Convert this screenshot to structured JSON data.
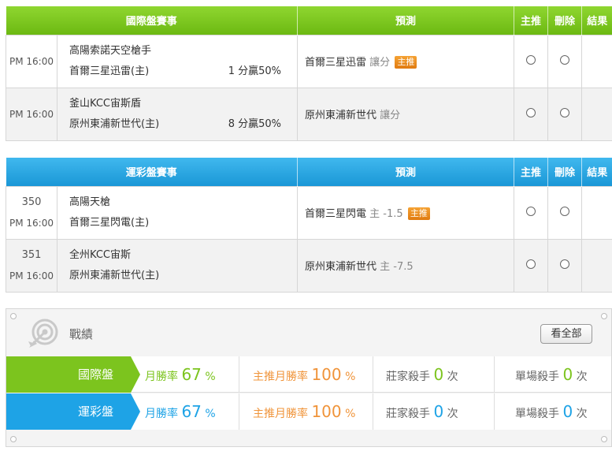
{
  "intl_table": {
    "headers": {
      "match": "國際盤賽事",
      "predict": "預測",
      "main": "主推",
      "delete": "刪除",
      "result": "結果"
    },
    "rows": [
      {
        "time": "PM 16:00",
        "team1": "高陽索諾天空槍手",
        "team2": "首爾三星迅雷(主)",
        "odds": "1 分贏50%",
        "pred_team": "首爾三星迅雷",
        "pred_type": "讓分",
        "tag": "主推"
      },
      {
        "time": "PM 16:00",
        "team1": "釜山KCC宙斯盾",
        "team2": "原州東浦新世代(主)",
        "odds": "8 分贏50%",
        "pred_team": "原州東浦新世代",
        "pred_type": "讓分",
        "tag": ""
      }
    ]
  },
  "lottery_table": {
    "headers": {
      "match": "運彩盤賽事",
      "predict": "預測",
      "main": "主推",
      "delete": "刪除",
      "result": "結果"
    },
    "rows": [
      {
        "num": "350",
        "time": "PM 16:00",
        "team1": "高陽天槍",
        "team2": "首爾三星閃電(主)",
        "pred_team": "首爾三星閃電",
        "pred_type": "主 -1.5",
        "tag": "主推"
      },
      {
        "num": "351",
        "time": "PM 16:00",
        "team1": "全州KCC宙斯",
        "team2": "原州東浦新世代(主)",
        "pred_team": "原州東浦新世代",
        "pred_type": "主 -7.5",
        "tag": ""
      }
    ]
  },
  "stats": {
    "title": "戰績",
    "view_all": "看全部",
    "icon": "target-icon",
    "rows": [
      {
        "label": "國際盤",
        "month_label": "月勝率",
        "month_value": "67",
        "main_label": "主推月勝率",
        "main_value": "100",
        "pct": "%",
        "dealer_label": "莊家殺手",
        "dealer_value": "0",
        "single_label": "單場殺手",
        "single_value": "0",
        "times": "次"
      },
      {
        "label": "運彩盤",
        "month_label": "月勝率",
        "month_value": "67",
        "main_label": "主推月勝率",
        "main_value": "100",
        "pct": "%",
        "dealer_label": "莊家殺手",
        "dealer_value": "0",
        "single_label": "單場殺手",
        "single_value": "0",
        "times": "次"
      }
    ]
  },
  "colors": {
    "green": "#7cc41e",
    "blue": "#1ea3e6",
    "orange": "#f0943a",
    "tag": "#f08a1e"
  }
}
